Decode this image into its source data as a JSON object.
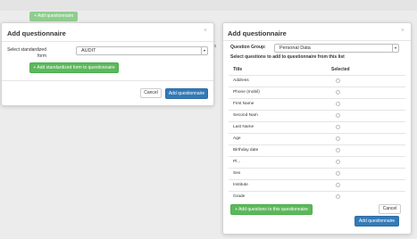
{
  "background": {
    "add_button_label": "+ Add questionnaire",
    "fragment_text": "ds"
  },
  "modal1": {
    "title": "Add questionnaire",
    "close_label": "×",
    "form_label": "Select standardized form",
    "select_value": "AUDIT",
    "add_form_button": "+ Add standardized form to questionnaire",
    "cancel_button": "Cancel",
    "submit_button": "Add questionnaire"
  },
  "modal2": {
    "title": "Add questionnaire",
    "close_label": "×",
    "group_label": "Question Group:",
    "group_value": "Personal Data",
    "instruction": "Select questions to add to questionnaire from this list",
    "columns": {
      "title": "Title",
      "selected": "Selected"
    },
    "rows": [
      "Address",
      "Phone (mobil)",
      "First Name",
      "Second Nam",
      "Last Name",
      "Age",
      "Birthday date",
      "Pl...",
      "Sex",
      "Institute",
      "Grade"
    ],
    "add_questions_button": "+ Add questions to this questionnaire",
    "cancel_button": "Cancel",
    "submit_button": "Add questionnaire"
  },
  "colors": {
    "green": "#5cb85c",
    "blue": "#337ab7",
    "background": "#ececec"
  }
}
